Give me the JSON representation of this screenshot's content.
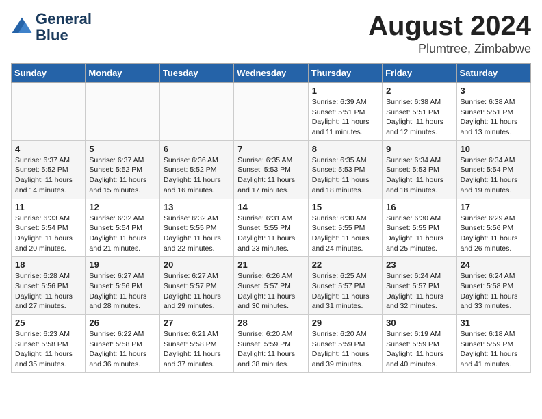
{
  "header": {
    "logo_line1": "General",
    "logo_line2": "Blue",
    "month_title": "August 2024",
    "location": "Plumtree, Zimbabwe"
  },
  "days_of_week": [
    "Sunday",
    "Monday",
    "Tuesday",
    "Wednesday",
    "Thursday",
    "Friday",
    "Saturday"
  ],
  "weeks": [
    [
      {
        "day": "",
        "info": ""
      },
      {
        "day": "",
        "info": ""
      },
      {
        "day": "",
        "info": ""
      },
      {
        "day": "",
        "info": ""
      },
      {
        "day": "1",
        "info": "Sunrise: 6:39 AM\nSunset: 5:51 PM\nDaylight: 11 hours\nand 11 minutes."
      },
      {
        "day": "2",
        "info": "Sunrise: 6:38 AM\nSunset: 5:51 PM\nDaylight: 11 hours\nand 12 minutes."
      },
      {
        "day": "3",
        "info": "Sunrise: 6:38 AM\nSunset: 5:51 PM\nDaylight: 11 hours\nand 13 minutes."
      }
    ],
    [
      {
        "day": "4",
        "info": "Sunrise: 6:37 AM\nSunset: 5:52 PM\nDaylight: 11 hours\nand 14 minutes."
      },
      {
        "day": "5",
        "info": "Sunrise: 6:37 AM\nSunset: 5:52 PM\nDaylight: 11 hours\nand 15 minutes."
      },
      {
        "day": "6",
        "info": "Sunrise: 6:36 AM\nSunset: 5:52 PM\nDaylight: 11 hours\nand 16 minutes."
      },
      {
        "day": "7",
        "info": "Sunrise: 6:35 AM\nSunset: 5:53 PM\nDaylight: 11 hours\nand 17 minutes."
      },
      {
        "day": "8",
        "info": "Sunrise: 6:35 AM\nSunset: 5:53 PM\nDaylight: 11 hours\nand 18 minutes."
      },
      {
        "day": "9",
        "info": "Sunrise: 6:34 AM\nSunset: 5:53 PM\nDaylight: 11 hours\nand 18 minutes."
      },
      {
        "day": "10",
        "info": "Sunrise: 6:34 AM\nSunset: 5:54 PM\nDaylight: 11 hours\nand 19 minutes."
      }
    ],
    [
      {
        "day": "11",
        "info": "Sunrise: 6:33 AM\nSunset: 5:54 PM\nDaylight: 11 hours\nand 20 minutes."
      },
      {
        "day": "12",
        "info": "Sunrise: 6:32 AM\nSunset: 5:54 PM\nDaylight: 11 hours\nand 21 minutes."
      },
      {
        "day": "13",
        "info": "Sunrise: 6:32 AM\nSunset: 5:55 PM\nDaylight: 11 hours\nand 22 minutes."
      },
      {
        "day": "14",
        "info": "Sunrise: 6:31 AM\nSunset: 5:55 PM\nDaylight: 11 hours\nand 23 minutes."
      },
      {
        "day": "15",
        "info": "Sunrise: 6:30 AM\nSunset: 5:55 PM\nDaylight: 11 hours\nand 24 minutes."
      },
      {
        "day": "16",
        "info": "Sunrise: 6:30 AM\nSunset: 5:55 PM\nDaylight: 11 hours\nand 25 minutes."
      },
      {
        "day": "17",
        "info": "Sunrise: 6:29 AM\nSunset: 5:56 PM\nDaylight: 11 hours\nand 26 minutes."
      }
    ],
    [
      {
        "day": "18",
        "info": "Sunrise: 6:28 AM\nSunset: 5:56 PM\nDaylight: 11 hours\nand 27 minutes."
      },
      {
        "day": "19",
        "info": "Sunrise: 6:27 AM\nSunset: 5:56 PM\nDaylight: 11 hours\nand 28 minutes."
      },
      {
        "day": "20",
        "info": "Sunrise: 6:27 AM\nSunset: 5:57 PM\nDaylight: 11 hours\nand 29 minutes."
      },
      {
        "day": "21",
        "info": "Sunrise: 6:26 AM\nSunset: 5:57 PM\nDaylight: 11 hours\nand 30 minutes."
      },
      {
        "day": "22",
        "info": "Sunrise: 6:25 AM\nSunset: 5:57 PM\nDaylight: 11 hours\nand 31 minutes."
      },
      {
        "day": "23",
        "info": "Sunrise: 6:24 AM\nSunset: 5:57 PM\nDaylight: 11 hours\nand 32 minutes."
      },
      {
        "day": "24",
        "info": "Sunrise: 6:24 AM\nSunset: 5:58 PM\nDaylight: 11 hours\nand 33 minutes."
      }
    ],
    [
      {
        "day": "25",
        "info": "Sunrise: 6:23 AM\nSunset: 5:58 PM\nDaylight: 11 hours\nand 35 minutes."
      },
      {
        "day": "26",
        "info": "Sunrise: 6:22 AM\nSunset: 5:58 PM\nDaylight: 11 hours\nand 36 minutes."
      },
      {
        "day": "27",
        "info": "Sunrise: 6:21 AM\nSunset: 5:58 PM\nDaylight: 11 hours\nand 37 minutes."
      },
      {
        "day": "28",
        "info": "Sunrise: 6:20 AM\nSunset: 5:59 PM\nDaylight: 11 hours\nand 38 minutes."
      },
      {
        "day": "29",
        "info": "Sunrise: 6:20 AM\nSunset: 5:59 PM\nDaylight: 11 hours\nand 39 minutes."
      },
      {
        "day": "30",
        "info": "Sunrise: 6:19 AM\nSunset: 5:59 PM\nDaylight: 11 hours\nand 40 minutes."
      },
      {
        "day": "31",
        "info": "Sunrise: 6:18 AM\nSunset: 5:59 PM\nDaylight: 11 hours\nand 41 minutes."
      }
    ]
  ]
}
